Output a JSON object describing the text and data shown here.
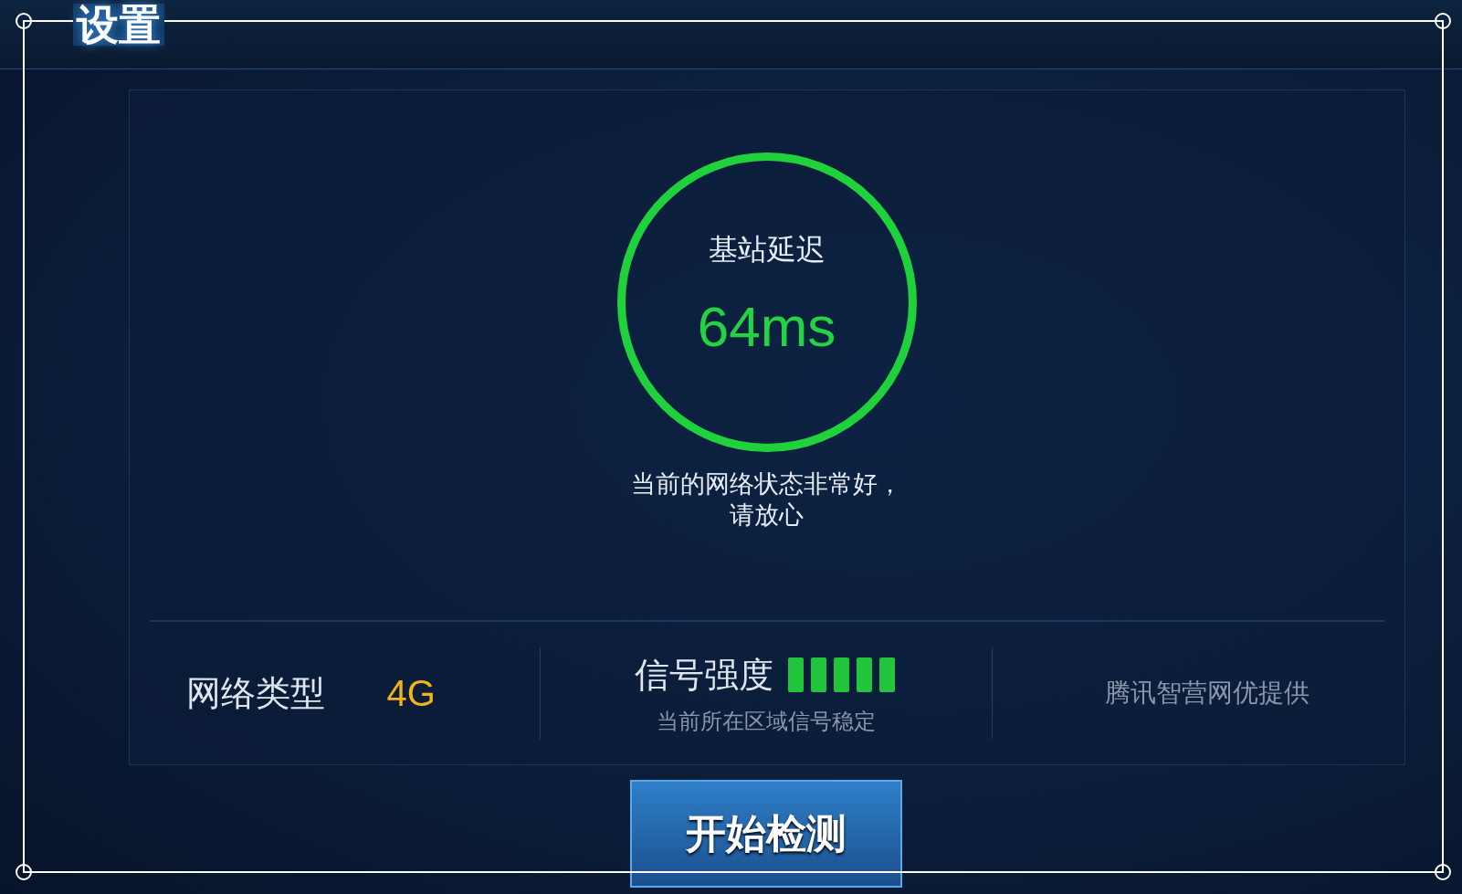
{
  "title": "设置",
  "latency": {
    "label": "基站延迟",
    "value": "64ms"
  },
  "status_message": [
    "当前的网络状态非常好，",
    "请放心"
  ],
  "network_type": {
    "label": "网络类型",
    "value": "4G"
  },
  "signal": {
    "label": "信号强度",
    "note": "当前所在区域信号稳定"
  },
  "provider": "腾讯智营网优提供",
  "button": "开始检测"
}
